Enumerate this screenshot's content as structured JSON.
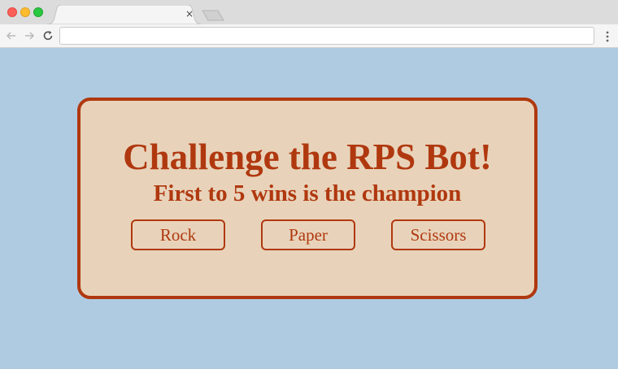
{
  "browser": {
    "tab_close": "×",
    "address_value": "",
    "icons": {
      "back": "arrow-left-icon",
      "forward": "arrow-right-icon",
      "reload": "reload-icon",
      "menu": "more-vertical-icon"
    }
  },
  "game": {
    "title": "Challenge the RPS Bot!",
    "subtitle": "First to 5 wins is the champion",
    "choices": {
      "rock": "Rock",
      "paper": "Paper",
      "scissors": "Scissors"
    }
  },
  "colors": {
    "page_background": "#afcbe1",
    "card_background": "#e8d3ba",
    "accent": "#b0380f"
  }
}
